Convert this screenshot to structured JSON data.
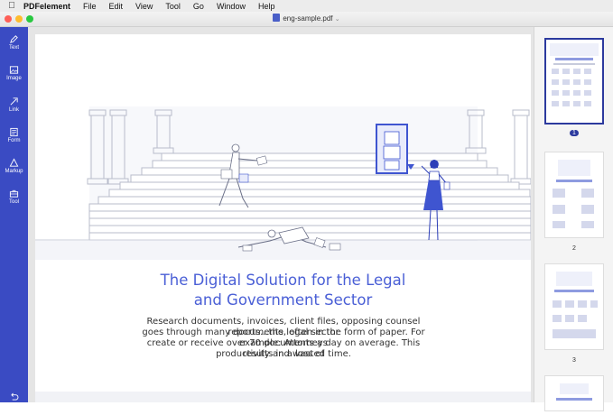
{
  "menubar": {
    "app_name": "PDFelement",
    "items": [
      "File",
      "Edit",
      "View",
      "Tool",
      "Go",
      "Window",
      "Help"
    ]
  },
  "window": {
    "doc_title": "eng-sample.pdf",
    "traffic_colors": [
      "#fe5f57",
      "#febc2e",
      "#28c840"
    ]
  },
  "sidebar": {
    "bg_color": "#3a4bc3",
    "tools": [
      {
        "label": "Text",
        "icon": "pen-icon"
      },
      {
        "label": "Image",
        "icon": "image-icon"
      },
      {
        "label": "Link",
        "icon": "link-icon"
      },
      {
        "label": "Form",
        "icon": "form-icon"
      },
      {
        "label": "Markup",
        "icon": "markup-icon"
      },
      {
        "label": "Tool",
        "icon": "toolbox-icon"
      }
    ],
    "back_icon": "undo-icon"
  },
  "document": {
    "headline_line1": "The Digital Solution for the Legal",
    "headline_line2": "and Government Sector",
    "paragraph": [
      "Research documents, invoices, client files, opposing counsel reports...the legal sector",
      "goes through many documents, often in the form of paper. For example: Attorneys",
      "create or receive over 70 documents a day on average. This results in a loss of",
      "productivity and wasted time."
    ],
    "accent_color": "#4a5fd6"
  },
  "thumbnails": {
    "pages": [
      "1",
      "2",
      "3"
    ],
    "selected": "1"
  }
}
